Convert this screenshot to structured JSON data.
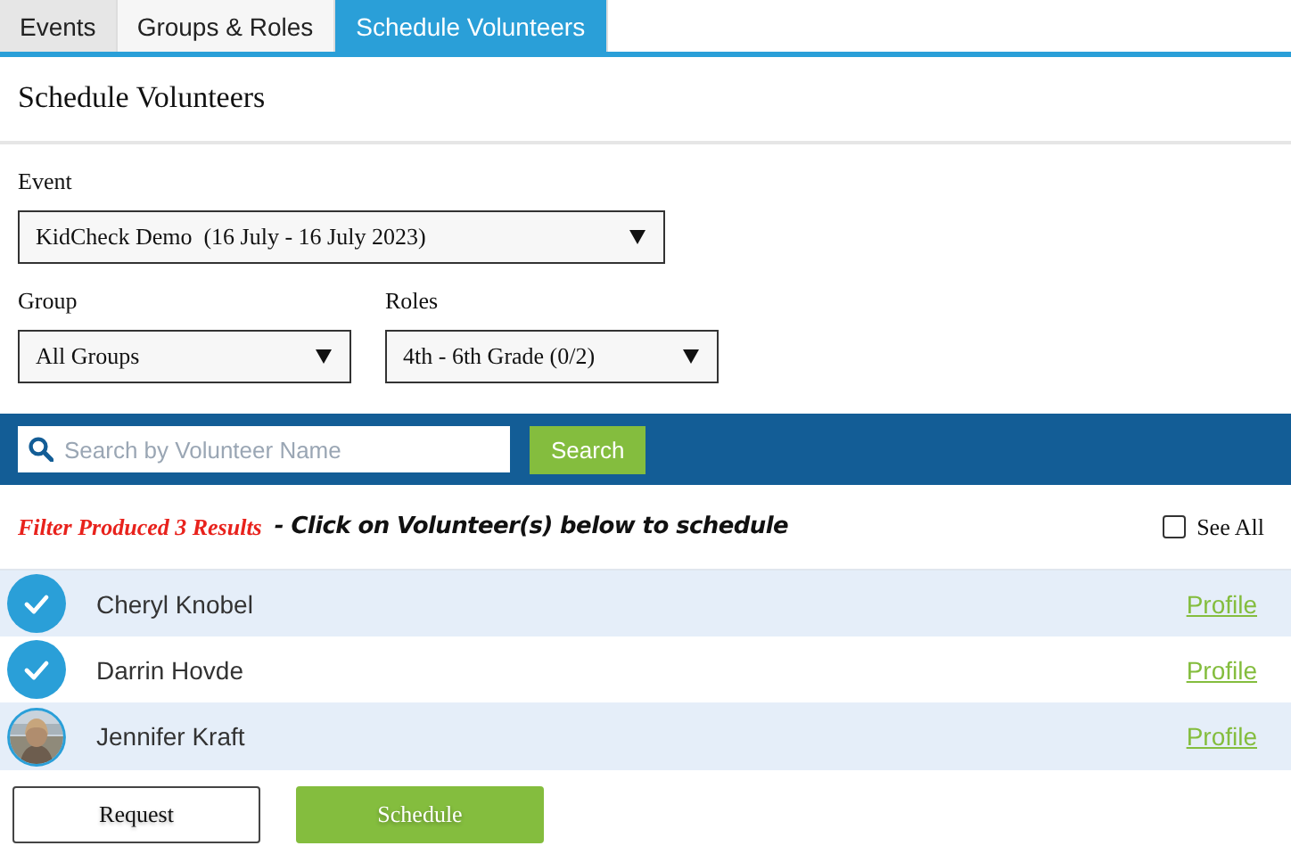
{
  "tabs": [
    {
      "label": "Events",
      "selected": false
    },
    {
      "label": "Groups & Roles",
      "selected": false
    },
    {
      "label": "Schedule Volunteers",
      "selected": true
    }
  ],
  "page_title": "Schedule Volunteers",
  "filters": [
    {
      "label": "Event",
      "value": "KidCheck Demo  (16 July - 16 July 2023)",
      "kind": "wide"
    },
    {
      "label": "Group",
      "value": "All Groups",
      "kind": "half"
    },
    {
      "label": "Roles",
      "value": "4th - 6th Grade (0/2)",
      "kind": "half"
    }
  ],
  "search": {
    "placeholder": "Search by Volunteer Name",
    "button": "Search"
  },
  "results": {
    "count_text": "Filter Produced 3 Results",
    "instruction": "- Click on Volunteer(s) below to schedule",
    "see_all": {
      "label": "See All",
      "checked": false
    }
  },
  "volunteers": [
    {
      "name": "Cheryl Knobel",
      "selected": true,
      "link": "Profile"
    },
    {
      "name": "Darrin Hovde",
      "selected": true,
      "link": "Profile"
    },
    {
      "name": "Jennifer Kraft",
      "selected": false,
      "link": "Profile"
    }
  ],
  "buttons": [
    {
      "label": "Request",
      "kind": "outline"
    },
    {
      "label": "Schedule",
      "kind": "primary"
    }
  ]
}
